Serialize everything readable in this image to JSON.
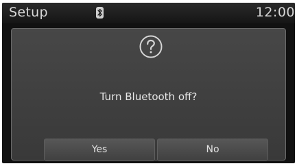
{
  "status_bar": {
    "title": "Setup",
    "bluetooth_icon": "bluetooth-icon",
    "clock": "12:00"
  },
  "dialog": {
    "icon": "question-mark-icon",
    "message": "Turn Bluetooth off?",
    "yes_label": "Yes",
    "no_label": "No"
  }
}
